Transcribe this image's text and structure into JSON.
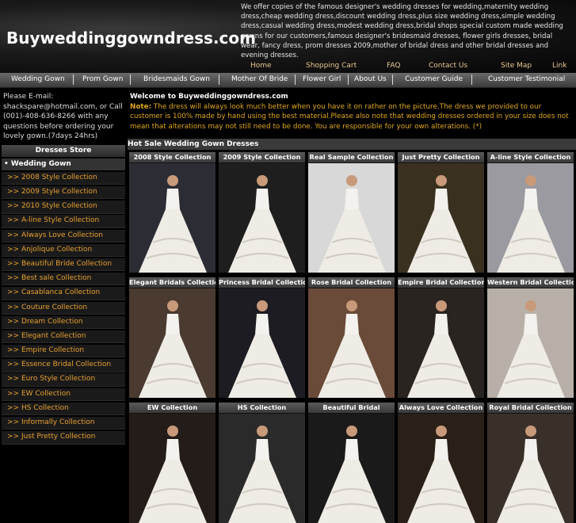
{
  "header": {
    "logo": "Buyweddinggowndress.com",
    "intro": "We offer copies of the famous designer's wedding dresses for wedding,maternity wedding dress,cheap wedding dress,discount wedding dress,plus size wedding dress,simple wedding dress,casual wedding dress,modest wedding dress,bridal shops special custom made wedding gowns for our customers,famous designer's bridesmaid dresses, flower girls dresses, bridal wear, fancy dress, prom dresses 2009,mother of bridal dress and other bridal dresses and evening dresses.",
    "links": [
      "Home",
      "Shopping Cart",
      "FAQ",
      "Contact Us",
      "Site Map",
      "Link"
    ]
  },
  "nav": [
    "Wedding Gown",
    "Prom Gown",
    "Bridesmaids Gown",
    "Mother Of Bride",
    "Flower Girl",
    "About Us",
    "Customer Guide",
    "Customer Testimonial"
  ],
  "sidebar": {
    "contact_line1": "Please E-mail:",
    "email": "shackspare@hotmail.com",
    "contact_rest": ", or Call (001)-408-636-8266 with any questions before ordering your lovely gown.(7days 24hrs)",
    "store_title": "Dresses Store",
    "category": "• Wedding Gown",
    "items": [
      ">> 2008 Style Collection",
      ">> 2009 Style Collection",
      ">> 2010 Style Collection",
      ">> A-line Style Collection",
      ">> Always Love Collection",
      ">> Anjolique Collection",
      ">> Beautiful Bride Collection",
      ">> Best sale Collection",
      ">> Casablanca Collection",
      ">> Couture Collection",
      ">> Dream Collection",
      ">> Elegant Collection",
      ">> Empire Collection",
      ">> Essence Bridal Collection",
      ">> Euro Style Collection",
      ">> EW Collection",
      ">> HS Collection",
      ">> Informally Collection",
      ">> Just Pretty Collection"
    ]
  },
  "main": {
    "welcome": "Welcome to Buyweddinggowndress.com",
    "note_label": "Note:",
    "note_text": " The dress will always look much better when you have it on rather on the picture.The dress we provided to our customer is 100% made by hand using the best material.Please also note that wedding dresses ordered in your size does not mean that alterations may not still need to be done. You are responsible for your own alterations. (*)",
    "section_title": "Hot Sale Wedding Gown Dresses",
    "gowns": [
      "2008 Style Collection",
      "2009 Style Collection",
      "Real Sample Collection",
      "Just Pretty Collection",
      "A-line Style Collection",
      "Elegant Bridals Collection",
      "Princess Bridal Collection",
      "Rose Bridal Collection",
      "Empire Bridal Collection",
      "Western Bridal Collection",
      "EW Collection",
      "HS Collection",
      "Beautiful Bridal",
      "Always Love Collection",
      "Royal Bridal Collection"
    ]
  },
  "colors": {
    "accent": "#e8a030",
    "note": "#e0a820",
    "link": "#e8c890",
    "bg": "#000000"
  }
}
